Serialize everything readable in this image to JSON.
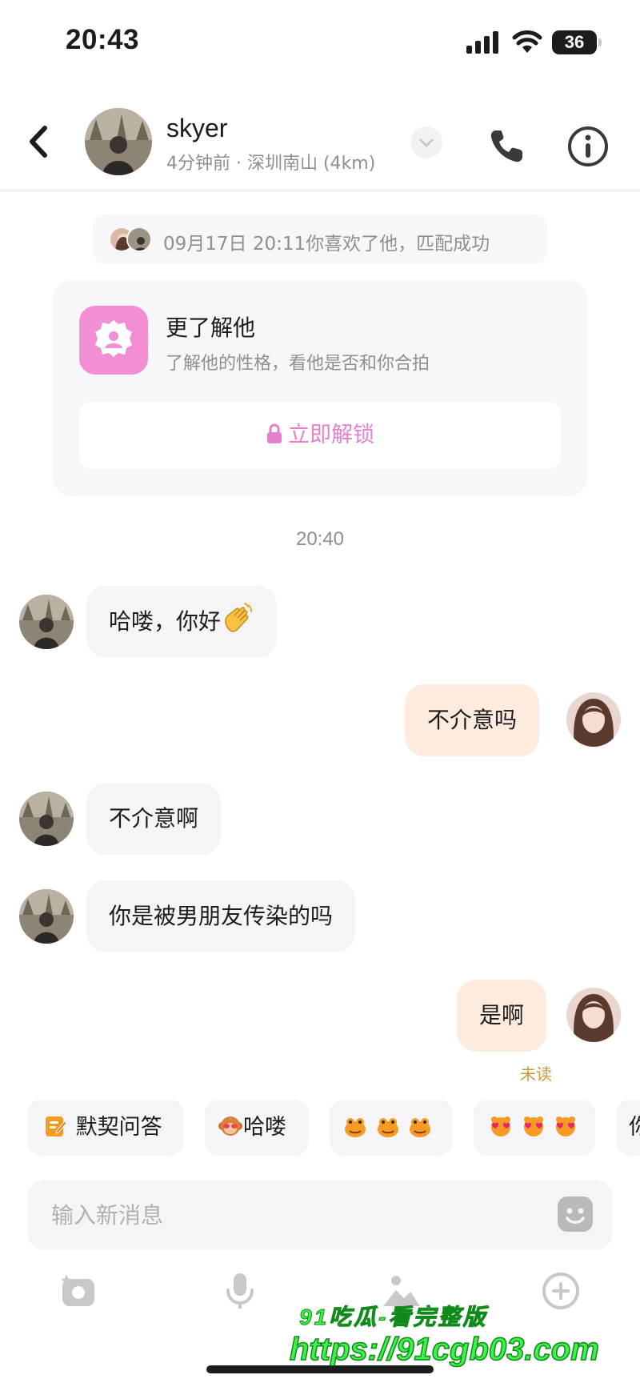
{
  "status_bar": {
    "time": "20:43",
    "battery": "36"
  },
  "header": {
    "name": "skyer",
    "subtitle": "4分钟前 · 深圳南山 (4km)"
  },
  "match_notice": {
    "text": "09月17日 20:11你喜欢了他，匹配成功"
  },
  "know_card": {
    "title": "更了解他",
    "description": "了解他的性格，看他是否和你合拍",
    "unlock_label": "立即解锁"
  },
  "time_divider": "20:40",
  "messages": [
    {
      "side": "in",
      "text": "哈喽，你好"
    },
    {
      "side": "out",
      "text": "不介意吗"
    },
    {
      "side": "in",
      "text": "不介意啊"
    },
    {
      "side": "in",
      "text": "你是被男朋友传染的吗"
    },
    {
      "side": "out",
      "text": "是啊",
      "status": "未读"
    }
  ],
  "quick_replies": [
    {
      "label": "默契问答",
      "icon": "edit-note-icon"
    },
    {
      "label": "哈喽",
      "icon": "monkey-sticker-icon"
    },
    {
      "label": "",
      "icon": "frog-sticker-icon"
    },
    {
      "label": "",
      "icon": "heart-bear-sticker-icon"
    },
    {
      "label": "你",
      "icon": ""
    }
  ],
  "input": {
    "placeholder": "输入新消息"
  },
  "toolbar": [
    "camera-icon",
    "microphone-icon",
    "image-icon",
    "add-icon"
  ],
  "watermark": {
    "line1": "91吃瓜-看完整版",
    "line2": "https://91cgb03.com"
  },
  "colors": {
    "accent": "#e87fce",
    "outgoing_bubble": "#fdecdd",
    "incoming_bubble": "#f5f5f7",
    "unread": "#c99a3b"
  }
}
